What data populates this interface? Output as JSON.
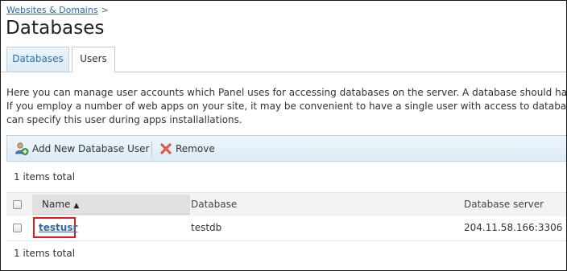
{
  "breadcrumb": {
    "link": "Websites & Domains",
    "separator": ">"
  },
  "page": {
    "title": "Databases"
  },
  "tabs": [
    {
      "label": "Databases",
      "active": false
    },
    {
      "label": "Users",
      "active": true
    }
  ],
  "description": {
    "line1": "Here you can manage user accounts which Panel uses for accessing databases on the server. A database should have at",
    "line2": "If you employ a number of web apps on your site, it may be convenient to have a single user with access to databases o",
    "line3": "can specify this user during apps installallations."
  },
  "toolbar": {
    "add_label": "Add New Database User",
    "add_icon": "add-user-icon",
    "remove_label": "Remove",
    "remove_icon": "remove-x-icon"
  },
  "list": {
    "items_total_top": "1 items total",
    "items_total_bottom": "1 items total",
    "columns": {
      "name": "Name",
      "database": "Database",
      "server": "Database server"
    },
    "sort_indicator": "▲",
    "rows": [
      {
        "name": "testusr",
        "database": "testdb",
        "server": "204.11.58.166:3306"
      }
    ]
  },
  "colors": {
    "link": "#2f68a3",
    "highlight_border": "#e01b1b",
    "toolbar_bg": "#dceaf5"
  }
}
